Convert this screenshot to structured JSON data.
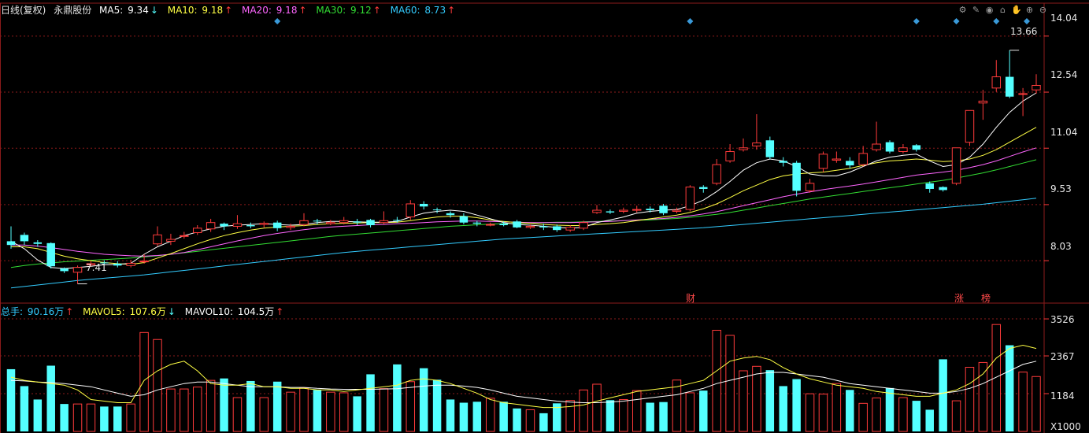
{
  "header": {
    "period": "日线(复权)",
    "stock_name": "永鼎股份",
    "ma5": {
      "label": "MA5: ",
      "value": "9.34",
      "arrow": "↓",
      "color": "#ffffff"
    },
    "ma10": {
      "label": "MA10: ",
      "value": "9.18",
      "arrow": "↑",
      "color": "#ffff44"
    },
    "ma20": {
      "label": "MA20: ",
      "value": "9.18",
      "arrow": "↑",
      "color": "#ff66ff"
    },
    "ma30": {
      "label": "MA30: ",
      "value": "9.12",
      "arrow": "↑",
      "color": "#33dd33"
    },
    "ma60": {
      "label": "MA60: ",
      "value": "8.73",
      "arrow": "↑",
      "color": "#33ccff"
    }
  },
  "vol_header": {
    "total": {
      "label": "总手: ",
      "value": "90.16万",
      "arrow": "↑",
      "color": "#33ccff"
    },
    "mavol5": {
      "label": "MAVOL5: ",
      "value": "107.6万",
      "arrow": "↓",
      "color": "#ffff44"
    },
    "mavol10": {
      "label": "MAVOL10: ",
      "value": "104.5万",
      "arrow": "↑",
      "color": "#ffffff"
    }
  },
  "toolbar_icons": [
    "settings-icon",
    "pen-icon",
    "eye-icon",
    "bag-icon",
    "hand-icon",
    "zoom-in-icon",
    "zoom-out-icon"
  ],
  "price_axis": [
    "14.04",
    "12.54",
    "11.04",
    "9.53",
    "8.03"
  ],
  "vol_axis": [
    "3526",
    "2367",
    "1184"
  ],
  "vol_unit": "X1000",
  "annotations": {
    "low": "7.41",
    "high": "13.66",
    "cai": "财",
    "zhang": "涨",
    "bang": "榜"
  },
  "colors": {
    "up": "#ff3b3b",
    "down": "#54ffff",
    "grid": "#8b1b1b"
  },
  "chart_data": {
    "type": "candlestick",
    "price_range": [
      7.0,
      14.5
    ],
    "volume_range": [
      0,
      3700
    ],
    "candles": [
      [
        8.55,
        8.45,
        8.95,
        8.35
      ],
      [
        8.72,
        8.55,
        8.78,
        8.45
      ],
      [
        8.52,
        8.48,
        8.58,
        8.4
      ],
      [
        8.5,
        7.88,
        8.52,
        7.82
      ],
      [
        7.82,
        7.75,
        7.85,
        7.7
      ],
      [
        7.72,
        7.85,
        7.9,
        7.41
      ],
      [
        7.92,
        7.95,
        8.02,
        7.88
      ],
      [
        7.98,
        7.96,
        8.04,
        7.92
      ],
      [
        7.95,
        7.9,
        8.02,
        7.85
      ],
      [
        7.9,
        7.96,
        8.05,
        7.85
      ],
      [
        8.0,
        8.02,
        8.2,
        7.95
      ],
      [
        8.48,
        8.72,
        8.95,
        8.42
      ],
      [
        8.55,
        8.6,
        8.75,
        8.45
      ],
      [
        8.68,
        8.7,
        8.8,
        8.62
      ],
      [
        8.78,
        8.9,
        8.98,
        8.72
      ],
      [
        8.88,
        9.05,
        9.15,
        8.8
      ],
      [
        9.02,
        8.95,
        9.05,
        8.85
      ],
      [
        8.95,
        9.02,
        9.25,
        8.88
      ],
      [
        8.98,
        8.95,
        9.05,
        8.9
      ],
      [
        9.0,
        9.03,
        9.08,
        8.92
      ],
      [
        9.05,
        8.9,
        9.1,
        8.82
      ],
      [
        8.92,
        8.95,
        9.02,
        8.85
      ],
      [
        9.0,
        9.1,
        9.3,
        8.95
      ],
      [
        9.1,
        9.08,
        9.15,
        9.0
      ],
      [
        9.02,
        9.05,
        9.12,
        8.98
      ],
      [
        9.05,
        9.1,
        9.2,
        9.0
      ],
      [
        9.08,
        9.05,
        9.15,
        8.98
      ],
      [
        9.12,
        8.98,
        9.15,
        8.92
      ],
      [
        9.05,
        9.1,
        9.35,
        9.0
      ],
      [
        9.12,
        9.1,
        9.2,
        9.05
      ],
      [
        9.2,
        9.55,
        9.65,
        9.12
      ],
      [
        9.55,
        9.48,
        9.62,
        9.4
      ],
      [
        9.4,
        9.38,
        9.45,
        9.3
      ],
      [
        9.3,
        9.25,
        9.35,
        9.18
      ],
      [
        9.22,
        9.05,
        9.3,
        9.0
      ],
      [
        9.05,
        9.02,
        9.1,
        8.95
      ],
      [
        9.0,
        9.0,
        9.05,
        8.95
      ],
      [
        9.02,
        8.98,
        9.08,
        8.95
      ],
      [
        9.08,
        8.92,
        9.12,
        8.9
      ],
      [
        8.92,
        8.95,
        9.0,
        8.88
      ],
      [
        8.95,
        8.92,
        9.02,
        8.85
      ],
      [
        8.95,
        8.85,
        9.0,
        8.8
      ],
      [
        8.85,
        8.92,
        8.98,
        8.8
      ],
      [
        8.9,
        9.05,
        9.1,
        8.85
      ],
      [
        9.32,
        9.38,
        9.52,
        9.28
      ],
      [
        9.35,
        9.32,
        9.4,
        9.28
      ],
      [
        9.35,
        9.38,
        9.45,
        9.3
      ],
      [
        9.38,
        9.4,
        9.5,
        9.32
      ],
      [
        9.42,
        9.38,
        9.48,
        9.32
      ],
      [
        9.5,
        9.3,
        9.55,
        9.25
      ],
      [
        9.35,
        9.38,
        9.45,
        9.3
      ],
      [
        9.4,
        10.0,
        10.05,
        9.35
      ],
      [
        10.0,
        9.95,
        10.05,
        9.85
      ],
      [
        10.1,
        10.6,
        10.75,
        10.05
      ],
      [
        10.7,
        10.95,
        11.15,
        10.65
      ],
      [
        11.0,
        11.05,
        11.3,
        10.95
      ],
      [
        11.1,
        11.18,
        11.95,
        11.0
      ],
      [
        11.25,
        10.8,
        11.35,
        10.75
      ],
      [
        10.7,
        10.65,
        10.8,
        10.55
      ],
      [
        10.65,
        9.9,
        10.7,
        9.75
      ],
      [
        9.9,
        10.1,
        10.22,
        9.85
      ],
      [
        10.5,
        10.88,
        10.95,
        10.4
      ],
      [
        10.72,
        10.75,
        10.95,
        10.65
      ],
      [
        10.7,
        10.58,
        10.8,
        10.5
      ],
      [
        10.6,
        10.9,
        11.1,
        10.55
      ],
      [
        11.0,
        11.15,
        11.75,
        10.95
      ],
      [
        11.2,
        10.95,
        11.25,
        10.9
      ],
      [
        10.95,
        11.05,
        11.15,
        10.9
      ],
      [
        11.12,
        11.0,
        11.15,
        10.95
      ],
      [
        10.1,
        9.95,
        10.15,
        9.85
      ],
      [
        10.0,
        9.92,
        10.02,
        9.88
      ],
      [
        10.1,
        11.05,
        11.05,
        10.05
      ],
      [
        11.2,
        12.05,
        12.05,
        11.1
      ],
      [
        12.25,
        12.3,
        12.6,
        11.8
      ],
      [
        12.65,
        12.95,
        13.4,
        12.55
      ],
      [
        12.95,
        12.42,
        13.66,
        12.38
      ],
      [
        12.48,
        12.5,
        12.65,
        11.9
      ],
      [
        12.6,
        12.72,
        13.02,
        12.5
      ]
    ],
    "volumes": [
      1950,
      1420,
      1000,
      2060,
      860,
      860,
      860,
      780,
      780,
      860,
      3100,
      2880,
      1330,
      1330,
      1390,
      1600,
      1660,
      1060,
      1580,
      1060,
      1560,
      1230,
      1360,
      1300,
      1230,
      1210,
      1100,
      1790,
      1340,
      2100,
      1560,
      1980,
      1620,
      1000,
      900,
      930,
      1040,
      930,
      720,
      680,
      570,
      880,
      970,
      1300,
      1480,
      980,
      1000,
      1280,
      900,
      920,
      1610,
      1210,
      1280,
      3170,
      3010,
      1900,
      2040,
      1920,
      1420,
      1640,
      1180,
      1170,
      1500,
      1300,
      880,
      1050,
      1360,
      1060,
      960,
      680,
      2260,
      960,
      2010,
      2160,
      3350,
      2700,
      1860,
      1720
    ],
    "ma5": [
      8.55,
      8.35,
      8.05,
      7.85,
      7.82,
      7.85,
      7.88,
      7.92,
      7.93,
      7.96,
      8.2,
      8.4,
      8.55,
      8.7,
      8.8,
      8.88,
      8.95,
      8.98,
      9.0,
      9.02,
      9.0,
      8.98,
      9.0,
      9.05,
      9.08,
      9.08,
      9.07,
      9.06,
      9.06,
      9.08,
      9.2,
      9.3,
      9.35,
      9.38,
      9.35,
      9.25,
      9.15,
      9.05,
      9.0,
      8.98,
      8.95,
      8.92,
      8.9,
      8.92,
      9.05,
      9.12,
      9.2,
      9.3,
      9.35,
      9.38,
      9.4,
      9.5,
      9.65,
      9.88,
      10.15,
      10.45,
      10.65,
      10.75,
      10.7,
      10.55,
      10.35,
      10.3,
      10.3,
      10.4,
      10.55,
      10.7,
      10.8,
      10.85,
      10.88,
      10.7,
      10.55,
      10.6,
      10.8,
      11.15,
      11.6,
      12.0,
      12.3,
      12.52
    ],
    "ma10": [
      8.4,
      8.4,
      8.35,
      8.25,
      8.15,
      8.08,
      8.03,
      7.98,
      7.95,
      7.93,
      7.98,
      8.1,
      8.22,
      8.35,
      8.48,
      8.6,
      8.7,
      8.78,
      8.85,
      8.9,
      8.93,
      8.95,
      8.97,
      9.0,
      9.02,
      9.03,
      9.04,
      9.05,
      9.05,
      9.06,
      9.1,
      9.15,
      9.2,
      9.22,
      9.22,
      9.18,
      9.12,
      9.08,
      9.05,
      9.03,
      9.0,
      8.98,
      8.97,
      8.97,
      9.0,
      9.02,
      9.05,
      9.1,
      9.15,
      9.2,
      9.25,
      9.32,
      9.42,
      9.55,
      9.72,
      9.9,
      10.05,
      10.2,
      10.3,
      10.35,
      10.38,
      10.4,
      10.45,
      10.5,
      10.58,
      10.65,
      10.7,
      10.72,
      10.75,
      10.72,
      10.68,
      10.7,
      10.75,
      10.85,
      11.0,
      11.2,
      11.4,
      11.6
    ],
    "ma20": [
      8.45,
      8.45,
      8.42,
      8.38,
      8.33,
      8.28,
      8.24,
      8.2,
      8.18,
      8.16,
      8.15,
      8.17,
      8.2,
      8.25,
      8.32,
      8.4,
      8.48,
      8.56,
      8.63,
      8.7,
      8.76,
      8.81,
      8.86,
      8.9,
      8.93,
      8.95,
      8.97,
      8.99,
      9.0,
      9.02,
      9.03,
      9.05,
      9.07,
      9.08,
      9.09,
      9.09,
      9.08,
      9.07,
      9.06,
      9.05,
      9.05,
      9.05,
      9.05,
      9.06,
      9.07,
      9.08,
      9.1,
      9.12,
      9.14,
      9.16,
      9.19,
      9.23,
      9.28,
      9.34,
      9.42,
      9.5,
      9.58,
      9.66,
      9.74,
      9.81,
      9.87,
      9.93,
      9.98,
      10.03,
      10.08,
      10.14,
      10.2,
      10.26,
      10.32,
      10.36,
      10.4,
      10.45,
      10.52,
      10.6,
      10.7,
      10.82,
      10.94,
      11.05
    ],
    "ma30": [
      7.85,
      7.9,
      7.94,
      7.97,
      8.0,
      8.02,
      8.04,
      8.06,
      8.08,
      8.1,
      8.13,
      8.16,
      8.2,
      8.24,
      8.28,
      8.32,
      8.36,
      8.4,
      8.44,
      8.48,
      8.52,
      8.56,
      8.6,
      8.64,
      8.68,
      8.71,
      8.74,
      8.77,
      8.8,
      8.83,
      8.86,
      8.89,
      8.92,
      8.95,
      8.97,
      8.99,
      9.01,
      9.02,
      9.03,
      9.04,
      9.05,
      9.06,
      9.06,
      9.07,
      9.08,
      9.09,
      9.1,
      9.11,
      9.12,
      9.14,
      9.16,
      9.19,
      9.23,
      9.27,
      9.32,
      9.38,
      9.44,
      9.5,
      9.56,
      9.62,
      9.68,
      9.73,
      9.78,
      9.83,
      9.88,
      9.93,
      9.98,
      10.03,
      10.08,
      10.13,
      10.18,
      10.24,
      10.31,
      10.38,
      10.46,
      10.55,
      10.64,
      10.73
    ],
    "ma60": [
      7.3,
      7.34,
      7.38,
      7.42,
      7.46,
      7.5,
      7.53,
      7.56,
      7.59,
      7.62,
      7.65,
      7.69,
      7.73,
      7.77,
      7.81,
      7.85,
      7.89,
      7.93,
      7.97,
      8.01,
      8.05,
      8.09,
      8.13,
      8.17,
      8.21,
      8.25,
      8.28,
      8.31,
      8.34,
      8.37,
      8.4,
      8.43,
      8.46,
      8.49,
      8.52,
      8.55,
      8.58,
      8.61,
      8.63,
      8.65,
      8.67,
      8.69,
      8.71,
      8.73,
      8.75,
      8.77,
      8.79,
      8.81,
      8.83,
      8.85,
      8.87,
      8.89,
      8.91,
      8.94,
      8.97,
      9.0,
      9.03,
      9.06,
      9.09,
      9.12,
      9.15,
      9.18,
      9.21,
      9.24,
      9.27,
      9.3,
      9.33,
      9.36,
      9.39,
      9.42,
      9.45,
      9.48,
      9.51,
      9.54,
      9.58,
      9.62,
      9.66,
      9.7
    ],
    "mavol5": [
      1700,
      1600,
      1550,
      1500,
      1450,
      1300,
      1000,
      950,
      900,
      900,
      1600,
      1900,
      2100,
      2200,
      1900,
      1500,
      1450,
      1450,
      1500,
      1400,
      1400,
      1350,
      1350,
      1300,
      1300,
      1250,
      1300,
      1350,
      1400,
      1450,
      1600,
      1650,
      1600,
      1500,
      1350,
      1200,
      1000,
      900,
      850,
      800,
      750,
      750,
      780,
      830,
      950,
      1050,
      1150,
      1250,
      1300,
      1350,
      1400,
      1500,
      1600,
      1900,
      2200,
      2300,
      2350,
      2250,
      2000,
      1800,
      1650,
      1550,
      1450,
      1400,
      1350,
      1250,
      1200,
      1150,
      1100,
      1100,
      1200,
      1300,
      1500,
      1800,
      2300,
      2600,
      2700,
      2600
    ],
    "mavol10": [
      1600,
      1580,
      1550,
      1530,
      1500,
      1450,
      1400,
      1300,
      1200,
      1100,
      1150,
      1300,
      1400,
      1500,
      1550,
      1550,
      1500,
      1450,
      1400,
      1400,
      1400,
      1380,
      1380,
      1350,
      1330,
      1320,
      1320,
      1320,
      1330,
      1340,
      1380,
      1420,
      1450,
      1450,
      1420,
      1380,
      1300,
      1200,
      1100,
      1050,
      1000,
      950,
      920,
      900,
      900,
      920,
      950,
      1000,
      1050,
      1100,
      1150,
      1250,
      1350,
      1500,
      1600,
      1700,
      1800,
      1850,
      1850,
      1800,
      1750,
      1700,
      1600,
      1500,
      1450,
      1400,
      1350,
      1300,
      1250,
      1200,
      1200,
      1250,
      1350,
      1500,
      1700,
      1900,
      2100,
      2200
    ]
  }
}
